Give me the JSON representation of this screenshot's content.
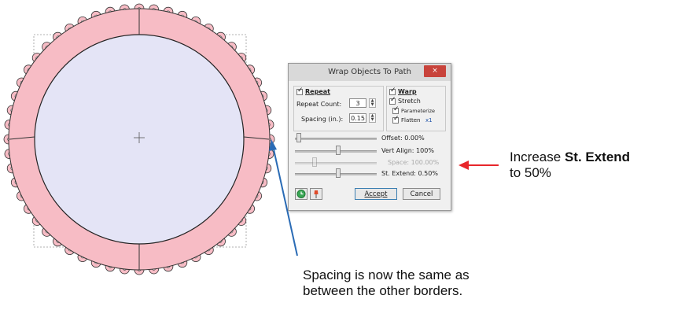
{
  "dialog": {
    "title": "Wrap Objects To Path",
    "close_glyph": "×",
    "repeat_label": "Repeat",
    "repeat_count_label": "Repeat Count:",
    "repeat_count_value": "3",
    "spacing_label": "Spacing (in.):",
    "spacing_value": "0.15",
    "warp_label": "Warp",
    "stretch_label": "Stretch",
    "parameterize_label": "Parameterize",
    "flatten_label": "Flatten",
    "flatten_suffix": "x1",
    "offset_label": "Offset: 0.00%",
    "vert_align_label": "Vert Align: 100%",
    "space_label": "Space: 100.00%",
    "st_extend_label": "St. Extend: 0.50%",
    "accept_label": "Accept",
    "cancel_label": "Cancel"
  },
  "annotations": {
    "increase_prefix": "Increase ",
    "increase_bold": "St. Extend",
    "increase_suffix": "to 50%",
    "spacing_note_line1": "Spacing is now the same as",
    "spacing_note_line2": "between the other borders."
  },
  "colors": {
    "ring_fill": "#f7bcc5",
    "inner_fill": "#e4e4f6",
    "red_arrow": "#e8262b",
    "blue_arrow": "#2a6bb5",
    "close_button": "#c8433b"
  },
  "icons": {
    "center_marker": "plus-icon",
    "clock_button": "clock-icon",
    "pin_button": "pin-icon"
  }
}
